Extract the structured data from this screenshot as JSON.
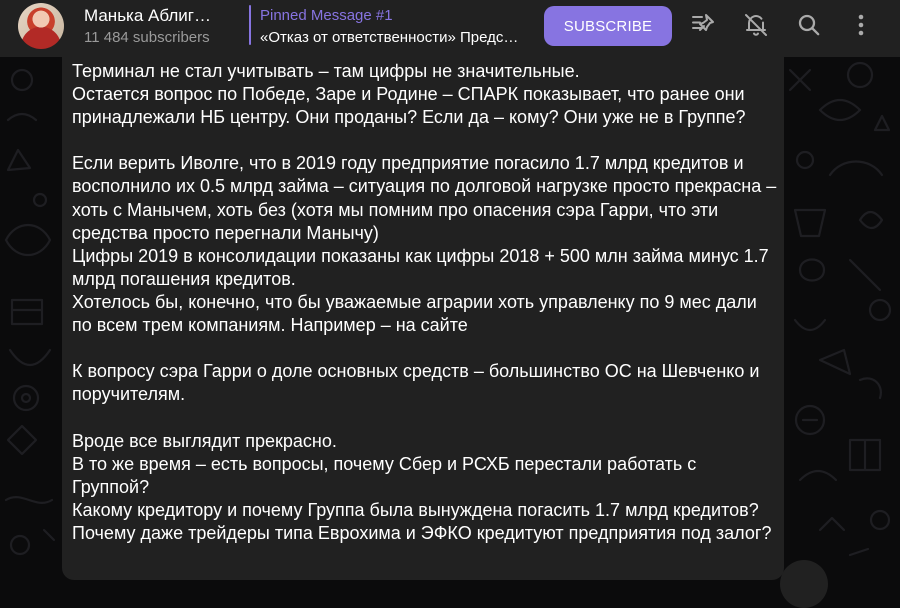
{
  "header": {
    "channel_title": "Манька Аблиг…",
    "subscribers": "11 484 subscribers",
    "pinned_title": "Pinned Message #1",
    "pinned_text": "«Отказ от ответственности» Предс…",
    "subscribe_label": "SUBSCRIBE",
    "icons": [
      "pinned-list-icon",
      "bell-off-icon",
      "search-icon",
      "more-vertical-icon"
    ]
  },
  "message": {
    "lines": [
      "Терминал не стал учитывать – там цифры не значительные.",
      "Остается вопрос по Победе, Заре и Родине – СПАРК показывает, что ранее они принадлежали НБ центру. Они проданы? Если да – кому? Они уже не в Группе?",
      "",
      "Если верить Иволге, что в 2019 году предприятие погасило 1.7 млрд кредитов и восполнило их 0.5 млрд займа – ситуация по долговой нагрузке просто прекрасна – хоть с Манычем, хоть без (хотя мы помним про опасения сэра Гарри, что эти средства просто перегнали Манычу)",
      "Цифры 2019 в консолидации показаны как цифры 2018 + 500 млн займа минус 1.7 млрд погашения кредитов.",
      "Хотелось бы, конечно, что бы уважаемые аграрии хоть управленку по 9 мес дали по всем трем компаниям. Например – на сайте",
      "",
      "К вопросу сэра Гарри о доле основных средств – большинство ОС на Шевченко и поручителям.",
      "",
      "Вроде все выглядит прекрасно.",
      "В то же время – есть вопросы, почему Сбер и РСХБ перестали работать с Группой?",
      "Какому кредитору и почему Группа была вынуждена погасить 1.7 млрд кредитов?",
      "Почему даже трейдеры типа Еврохима и ЭФКО кредитуют предприятия под залог?"
    ]
  },
  "colors": {
    "accent": "#8774e1",
    "header_bg": "#212121",
    "bubble_bg": "#212121",
    "page_bg": "#0b0b0c"
  }
}
